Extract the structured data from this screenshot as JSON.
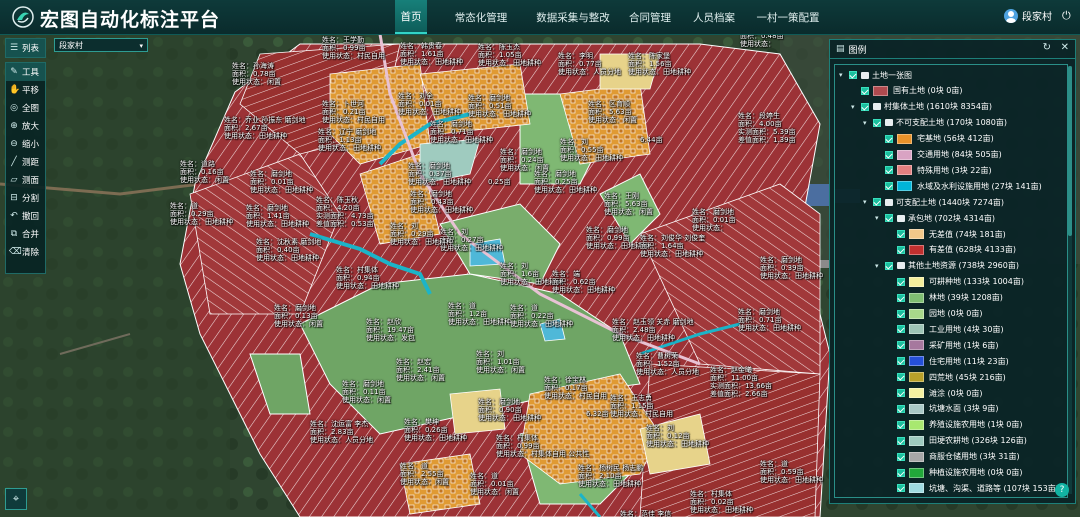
{
  "header": {
    "app_title": "宏图自动化标注平台",
    "nav": [
      {
        "label": "首页",
        "active": true
      },
      {
        "label": "常态化管理"
      },
      {
        "label": "数据采集与整改"
      },
      {
        "label": "合同管理"
      },
      {
        "label": "人员档案"
      },
      {
        "label": "一村一策配置"
      }
    ],
    "user_name": "段家村"
  },
  "map": {
    "village_select": "段家村",
    "toolbar_list": "列表",
    "tools": [
      "工具",
      "平移",
      "全图",
      "放大",
      "缩小",
      "测距",
      "测面",
      "分割",
      "撤回",
      "合并",
      "清除"
    ],
    "labels": [
      {
        "t": [
          "姓名：王学勤",
          "面积：0.99亩",
          "使用状态：村民自用"
        ],
        "l": 322,
        "tp": 36
      },
      {
        "t": [
          "姓名：韩贵春",
          "面积：1.61亩",
          "使用状态：田地耕种"
        ],
        "l": 400,
        "tp": 42
      },
      {
        "t": [
          "姓名：陈玉杰",
          "面积：1.05亩",
          "使用状态：田地耕种"
        ],
        "l": 478,
        "tp": 43
      },
      {
        "t": [
          "姓名：李明",
          "面积：0.77亩",
          "使用状态：人员分地"
        ],
        "l": 558,
        "tp": 52
      },
      {
        "t": [
          "姓名：陈家堡",
          "面积：1.56亩",
          "使用状态：田地耕种"
        ],
        "l": 628,
        "tp": 52
      },
      {
        "t": [
          "姓名：陈双林",
          "面积：0.48亩",
          "使用状态："
        ],
        "l": 740,
        "tp": 24
      },
      {
        "t": [
          "姓名：孙海涛",
          "面积：0.78亩",
          "使用状态：闲置"
        ],
        "l": 232,
        "tp": 62
      },
      {
        "t": [
          "姓名：卜世河",
          "面积：0.21亩",
          "使用状态：村民自用"
        ],
        "l": 322,
        "tp": 100
      },
      {
        "t": [
          "姓名：刘全",
          "面积：0.01亩",
          "使用状态：田地耕种"
        ],
        "l": 398,
        "tp": 92
      },
      {
        "t": [
          "姓名：磨剑地",
          "面积：0.51亩",
          "使用状态：田地耕种"
        ],
        "l": 468,
        "tp": 94
      },
      {
        "t": [
          "姓名：区育顺",
          "面积：5.63亩",
          "使用状态：闲置"
        ],
        "l": 588,
        "tp": 100
      },
      {
        "t": [
          "姓名：段婷生",
          "面积：4.00亩",
          "实测面积：5.39亩",
          "差值面积：1.39亩"
        ],
        "l": 738,
        "tp": 112
      },
      {
        "t": [
          "姓名：乔业 孙振东 磨剑地",
          "面积：2.67亩",
          "使用状态：田地耕种"
        ],
        "l": 224,
        "tp": 116
      },
      {
        "t": [
          "姓名：辽宁 磨剑地",
          "面积：1.13亩",
          "使用状态：田地耕种"
        ],
        "l": 318,
        "tp": 128
      },
      {
        "t": [
          "姓名：磨剑地",
          "面积：0.71亩",
          "使用状态：田地耕种"
        ],
        "l": 430,
        "tp": 120
      },
      {
        "t": [
          "姓名：刘",
          "面积：0.55亩",
          "使用状态：田地耕种"
        ],
        "l": 560,
        "tp": 138
      },
      {
        "t": [
          "6.44亩"
        ],
        "l": 640,
        "tp": 136
      },
      {
        "t": [
          "姓名：磨剑地",
          "面积：0.24亩",
          "使用状态：闲置"
        ],
        "l": 500,
        "tp": 148
      },
      {
        "t": [
          "姓名：道路",
          "面积：0.16亩",
          "使用状态：闲置"
        ],
        "l": 180,
        "tp": 160
      },
      {
        "t": [
          "姓名：磨剑地",
          "面积：0.01亩",
          "使用状态：田地耕种"
        ],
        "l": 250,
        "tp": 170
      },
      {
        "t": [
          "姓名：磨剑地",
          "面积：0.37亩",
          "使用状态：田地耕种"
        ],
        "l": 408,
        "tp": 162
      },
      {
        "t": [
          "0.25亩"
        ],
        "l": 488,
        "tp": 178
      },
      {
        "t": [
          "姓名：磨剑地",
          "面积：0.25亩",
          "使用状态：田地耕种"
        ],
        "l": 534,
        "tp": 170
      },
      {
        "t": [
          "姓名：磨剑地",
          "面积：0.43亩",
          "使用状态：田地耕种"
        ],
        "l": 410,
        "tp": 190
      },
      {
        "t": [
          "姓名：王刚",
          "面积：5.63亩",
          "使用状态：闲置"
        ],
        "l": 604,
        "tp": 192
      },
      {
        "t": [
          "姓名：陈玉秋",
          "面积：4.20亩",
          "实测面积：4.73亩",
          "差值面积：0.53亩"
        ],
        "l": 316,
        "tp": 196
      },
      {
        "t": [
          "姓名：道",
          "面积：0.29亩",
          "使用状态：田地耕种"
        ],
        "l": 170,
        "tp": 202
      },
      {
        "t": [
          "姓名：磨剑地",
          "面积：1.41亩",
          "使用状态：田地耕种"
        ],
        "l": 246,
        "tp": 204
      },
      {
        "t": [
          "姓名：磨剑地",
          "面积：0.01亩",
          "使用状态："
        ],
        "l": 692,
        "tp": 208
      },
      {
        "t": [
          "姓名：磨剑地",
          "面积：0.99亩",
          "使用状态：田地耕种"
        ],
        "l": 586,
        "tp": 226
      },
      {
        "t": [
          "姓名：刘",
          "面积：0.27亩",
          "使用状态：田地耕种"
        ],
        "l": 440,
        "tp": 228
      },
      {
        "t": [
          "姓名：刘",
          "面积：0.29亩",
          "使用状态：田地耕种"
        ],
        "l": 390,
        "tp": 222
      },
      {
        "t": [
          "姓名：沈秋素 磨剑地",
          "面积：0.40亩",
          "使用状态：田地耕种"
        ],
        "l": 256,
        "tp": 238
      },
      {
        "t": [
          "姓名：刘俊华 刘俊奎",
          "面积：1.64亩",
          "使用状态：田地耕种"
        ],
        "l": 640,
        "tp": 234
      },
      {
        "t": [
          "姓名：磨剑地",
          "面积：0.39亩",
          "使用状态：田地耕种"
        ],
        "l": 760,
        "tp": 256
      },
      {
        "t": [
          "姓名：刘",
          "面积：1.6亩",
          "使用状态：田地耕种"
        ],
        "l": 500,
        "tp": 262
      },
      {
        "t": [
          "姓名：村集体",
          "面积：0.94亩",
          "使用状态：田地耕种"
        ],
        "l": 336,
        "tp": 266
      },
      {
        "t": [
          "姓名：端",
          "面积：0.62亩",
          "使用状态：田地耕种"
        ],
        "l": 552,
        "tp": 270
      },
      {
        "t": [
          "姓名：磨剑地",
          "面积：0.13亩",
          "使用状态：闲置"
        ],
        "l": 274,
        "tp": 304
      },
      {
        "t": [
          "姓名：赵欣",
          "面积：19.47亩",
          "使用状态：发包"
        ],
        "l": 366,
        "tp": 318
      },
      {
        "t": [
          "姓名：道",
          "面积：1.2亩",
          "使用状态：田地耕种"
        ],
        "l": 448,
        "tp": 302
      },
      {
        "t": [
          "姓名：道",
          "面积：0.22亩",
          "使用状态：田地耕种"
        ],
        "l": 510,
        "tp": 304
      },
      {
        "t": [
          "姓名：赵玉领 关赤 磨剑地",
          "面积：2.48亩",
          "使用状态：田地耕种"
        ],
        "l": 612,
        "tp": 318
      },
      {
        "t": [
          "姓名：磨剑地",
          "面积：0.71亩",
          "使用状态：田地耕种"
        ],
        "l": 738,
        "tp": 308
      },
      {
        "t": [
          "姓名：刘",
          "面积：1.01亩",
          "使用状态：闲置"
        ],
        "l": 476,
        "tp": 350
      },
      {
        "t": [
          "姓名：曹树荣",
          "面积：1.52亩",
          "使用状态：人员分地"
        ],
        "l": 636,
        "tp": 352
      },
      {
        "t": [
          "姓名：赵宏",
          "面积：2.41亩",
          "使用状态：闲置"
        ],
        "l": 396,
        "tp": 358
      },
      {
        "t": [
          "姓名：赵金曦",
          "面积：11.00亩",
          "实测面积：13.66亩",
          "差值面积：2.66亩"
        ],
        "l": 710,
        "tp": 366
      },
      {
        "t": [
          "姓名：磨剑地",
          "面积：0.11亩",
          "使用状态：闲置"
        ],
        "l": 342,
        "tp": 380
      },
      {
        "t": [
          "姓名：徐宝林",
          "面积：0.17亩",
          "使用状态：村民自用"
        ],
        "l": 544,
        "tp": 376
      },
      {
        "t": [
          "姓名：磨剑地",
          "面积：0.90亩",
          "使用状态：田地耕种"
        ],
        "l": 478,
        "tp": 398
      },
      {
        "t": [
          "姓名：王志勇",
          "面积：1.15亩",
          "使用状态：村民自用"
        ],
        "l": 610,
        "tp": 394
      },
      {
        "t": [
          "6.32亩"
        ],
        "l": 586,
        "tp": 410
      },
      {
        "t": [
          "姓名：沈运富 李杰",
          "面积：2.83亩",
          "使用状态：人员分地"
        ],
        "l": 310,
        "tp": 420
      },
      {
        "t": [
          "姓名：樊坤",
          "面积：0.26亩",
          "使用状态：田地耕种"
        ],
        "l": 404,
        "tp": 418
      },
      {
        "t": [
          "姓名：村集体",
          "面积：0.99亩",
          "使用状态：村集体自用 公共性"
        ],
        "l": 496,
        "tp": 434
      },
      {
        "t": [
          "姓名：刘",
          "面积：0.12亩",
          "使用状态：田地耕种"
        ],
        "l": 646,
        "tp": 424
      },
      {
        "t": [
          "姓名：杨树民 杨志鹏",
          "面积：2.10亩",
          "使用状态：田地耕种"
        ],
        "l": 578,
        "tp": 464
      },
      {
        "t": [
          "姓名：道",
          "面积：0.59亩",
          "使用状态：田地耕种"
        ],
        "l": 760,
        "tp": 460
      },
      {
        "t": [
          "姓名：道",
          "面积：2.55亩",
          "使用状态：闲置"
        ],
        "l": 400,
        "tp": 462
      },
      {
        "t": [
          "姓名：道",
          "面积：0.01亩",
          "使用状态：闲置"
        ],
        "l": 470,
        "tp": 472
      },
      {
        "t": [
          "姓名：村集体",
          "面积：0.02亩",
          "使用状态：田地耕种"
        ],
        "l": 690,
        "tp": 490
      },
      {
        "t": [
          "姓名：范佳 李信",
          "面积：",
          "使用状态："
        ],
        "l": 620,
        "tp": 510
      }
    ]
  },
  "legend": {
    "title": "图例",
    "rows": [
      {
        "lvl": 0,
        "label": "土地一张图",
        "folder": true,
        "chev": "▾"
      },
      {
        "lvl": 1,
        "label": "国有土地 (0块 0亩)",
        "color": "#b04a4f"
      },
      {
        "lvl": 1,
        "label": "村集体土地 (1610块 8354亩)",
        "folder": true,
        "chev": "▾"
      },
      {
        "lvl": 2,
        "label": "不可支配土地 (170块 1080亩)",
        "folder": true,
        "chev": "▾"
      },
      {
        "lvl": 3,
        "label": "宅基地 (56块 412亩)",
        "color": "#e8922a"
      },
      {
        "lvl": 3,
        "label": "交通用地 (84块 505亩)",
        "color": "#d9a3c3"
      },
      {
        "lvl": 3,
        "label": "特殊用地 (3块 22亩)",
        "color": "#e28080"
      },
      {
        "lvl": 3,
        "label": "水域及水利设施用地 (27块 141亩)",
        "color": "#00b5d8"
      },
      {
        "lvl": 2,
        "label": "可支配土地 (1440块 7274亩)",
        "folder": true,
        "chev": "▾"
      },
      {
        "lvl": 3,
        "label": "承包地 (702块 4314亩)",
        "folder": true,
        "chev": "▾"
      },
      {
        "lvl": 4,
        "label": "无差值 (74块 181亩)",
        "color": "#f2c889"
      },
      {
        "lvl": 4,
        "label": "有差值 (628块 4133亩)",
        "color": "#c0302f"
      },
      {
        "lvl": 3,
        "label": "其他土地资源 (738块 2960亩)",
        "folder": true,
        "chev": "▾"
      },
      {
        "lvl": 4,
        "label": "可耕种地 (133块 1004亩)",
        "color": "#f3ef9c"
      },
      {
        "lvl": 4,
        "label": "林地 (39块 1208亩)",
        "color": "#7fbf72"
      },
      {
        "lvl": 4,
        "label": "园地 (0块 0亩)",
        "color": "#a8d88a"
      },
      {
        "lvl": 4,
        "label": "工业用地 (4块 30亩)",
        "color": "#9ec5b6"
      },
      {
        "lvl": 4,
        "label": "采矿用地 (1块 6亩)",
        "color": "#a6789e"
      },
      {
        "lvl": 4,
        "label": "住宅用地 (11块 23亩)",
        "color": "#2550d8"
      },
      {
        "lvl": 4,
        "label": "四荒地 (45块 216亩)",
        "color": "#b8a12a"
      },
      {
        "lvl": 4,
        "label": "滩涂 (0块 0亩)",
        "color": "#f2f0a0"
      },
      {
        "lvl": 4,
        "label": "坑塘水面 (3块 9亩)",
        "color": "#a9c9c6"
      },
      {
        "lvl": 4,
        "label": "养殖设施农用地 (1块 0亩)",
        "color": "#a8e870"
      },
      {
        "lvl": 4,
        "label": "田埂农耕地 (326块 126亩)",
        "color": "#9fcbbf"
      },
      {
        "lvl": 4,
        "label": "商服仓储用地 (3块 31亩)",
        "color": "#a7a7a7"
      },
      {
        "lvl": 4,
        "label": "种植设施农用地 (0块 0亩)",
        "color": "#22a83a"
      },
      {
        "lvl": 4,
        "label": "坑塘、沟渠、道路等 (107块 153亩)",
        "color": "#9fdbe0"
      }
    ]
  },
  "colors": {
    "accent": "#17807a",
    "parcel_red": "#9e3337",
    "orange": "#e0a030"
  }
}
